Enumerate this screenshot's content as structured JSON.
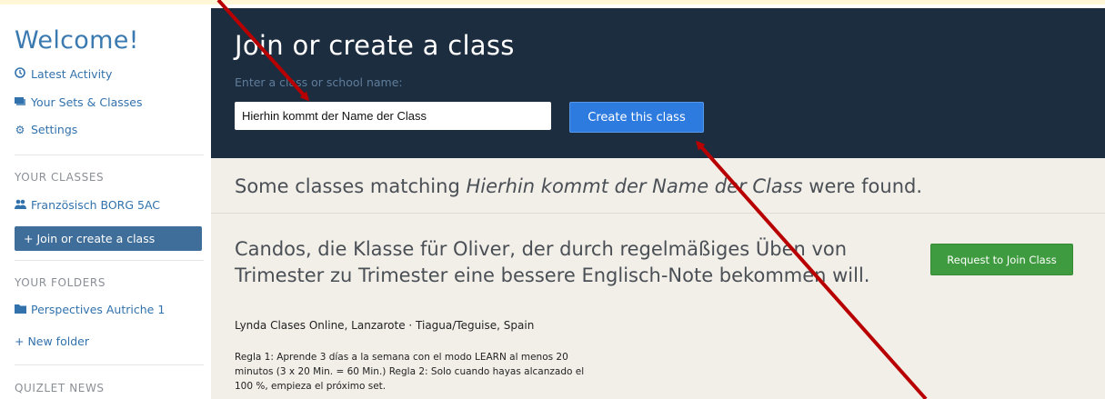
{
  "sidebar": {
    "welcome": "Welcome!",
    "links": [
      {
        "label": "Latest Activity",
        "icon": "clock-icon"
      },
      {
        "label": "Your Sets & Classes",
        "icon": "cards-icon"
      },
      {
        "label": "Settings",
        "icon": "gear-icon"
      }
    ],
    "classes_heading": "YOUR CLASSES",
    "classes": [
      {
        "label": "Französisch BORG 5AC",
        "icon": "people-icon"
      }
    ],
    "join_create_label": "+  Join or create a class",
    "folders_heading": "YOUR FOLDERS",
    "folders": [
      {
        "label": "Perspectives Autriche 1",
        "icon": "folder-icon"
      }
    ],
    "new_folder_label": "+  New folder",
    "news_heading": "QUIZLET NEWS"
  },
  "hero": {
    "title": "Join or create a class",
    "hint": "Enter a class or school name:",
    "input_value": "Hierhin kommt der Name der Class",
    "create_button": "Create this class"
  },
  "results": {
    "found_prefix": "Some classes matching ",
    "found_query": "Hierhin kommt der Name der Class",
    "found_suffix": " were found.",
    "class": {
      "title": "Candos, die Klasse für Oliver, der durch regelmäßiges Üben von Trimester zu Trimester eine bessere Englisch-Note bekommen will.",
      "meta": "Lynda Clases Online, Lanzarote · Tiagua/Teguise, Spain",
      "description": "Regla 1: Aprende 3 días a la semana con el modo LEARN al menos 20 minutos (3 x 20 Min. = 60 Min.) Regla 2: Solo cuando hayas alcanzado el 100 %, empieza el próximo set.",
      "join_button": "Request to Join Class"
    }
  },
  "colors": {
    "hero_bg": "#1d2d40",
    "primary_button": "#2e7be0",
    "join_button": "#3f9b3f",
    "active_nav": "#3f6e9a",
    "annotation_arrow": "#b80000"
  }
}
